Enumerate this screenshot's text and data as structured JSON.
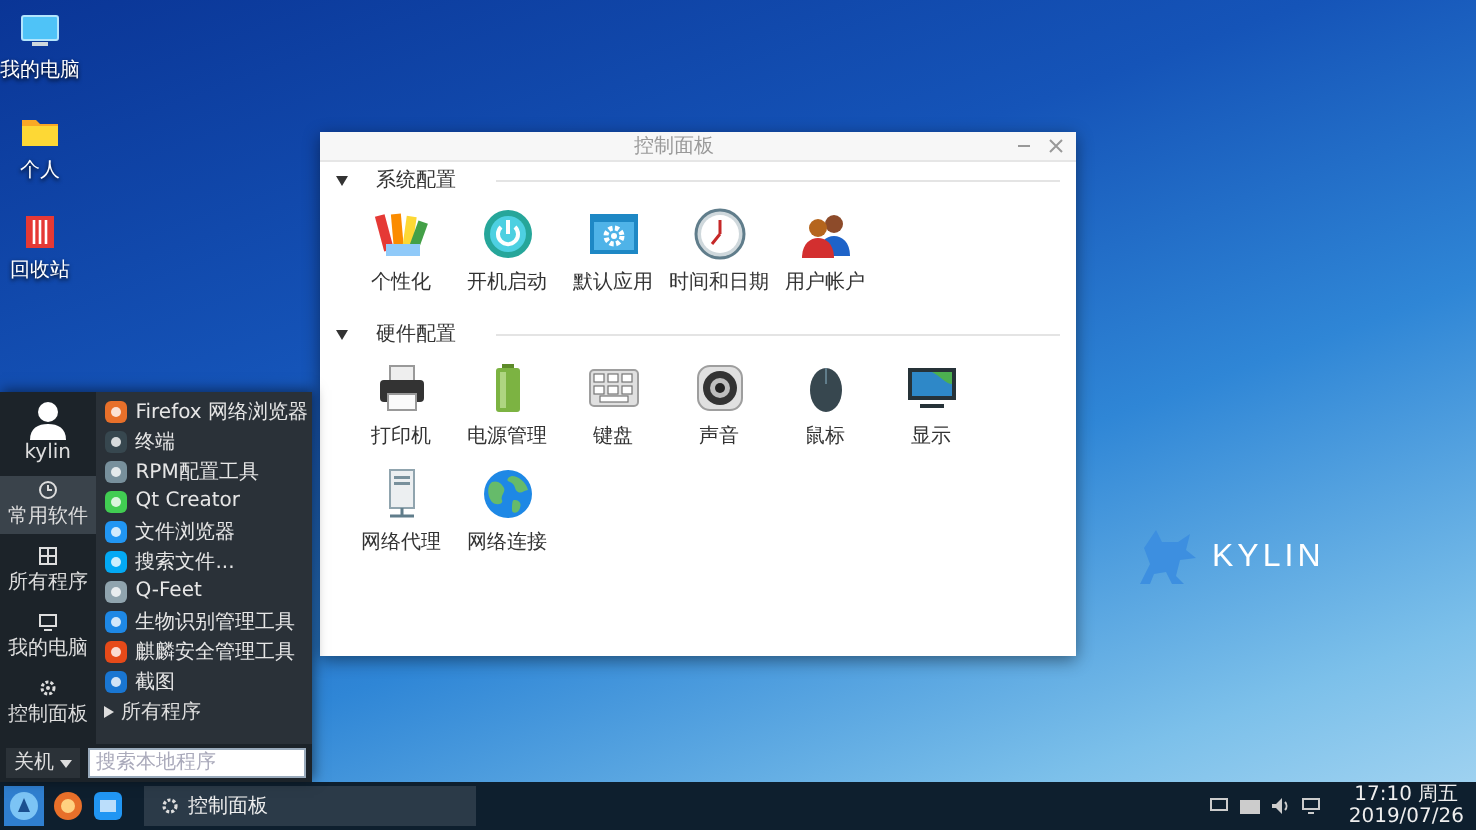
{
  "desktop": {
    "icons": [
      {
        "label": "我的电脑"
      },
      {
        "label": "个人"
      },
      {
        "label": "回收站"
      }
    ],
    "wallpaper_logo": {
      "text": "KYLIN"
    }
  },
  "control_panel": {
    "title": "控制面板",
    "sections": [
      {
        "title": "系统配置",
        "expanded": true,
        "items": [
          {
            "label": "个性化"
          },
          {
            "label": "开机启动"
          },
          {
            "label": "默认应用"
          },
          {
            "label": "时间和日期"
          },
          {
            "label": "用户帐户"
          }
        ]
      },
      {
        "title": "硬件配置",
        "expanded": true,
        "items": [
          {
            "label": "打印机"
          },
          {
            "label": "电源管理"
          },
          {
            "label": "键盘"
          },
          {
            "label": "声音"
          },
          {
            "label": "鼠标"
          },
          {
            "label": "显示"
          },
          {
            "label": "网络代理"
          },
          {
            "label": "网络连接"
          }
        ]
      }
    ]
  },
  "start_menu": {
    "user": "kylin",
    "categories": [
      {
        "label": "常用软件",
        "selected": true
      },
      {
        "label": "所有程序",
        "selected": false
      },
      {
        "label": "我的电脑",
        "selected": false
      },
      {
        "label": "控制面板",
        "selected": false
      }
    ],
    "apps": [
      {
        "label": "Firefox 网络浏览器"
      },
      {
        "label": "终端"
      },
      {
        "label": "RPM配置工具"
      },
      {
        "label": "Qt Creator"
      },
      {
        "label": "文件浏览器"
      },
      {
        "label": "搜索文件..."
      },
      {
        "label": "Q-Feet"
      },
      {
        "label": "生物识别管理工具"
      },
      {
        "label": "麒麟安全管理工具"
      },
      {
        "label": "截图"
      }
    ],
    "all_programs": "所有程序",
    "power_button": "关机",
    "search": {
      "placeholder": "搜索本地程序"
    }
  },
  "taskbar": {
    "tasks": [
      {
        "label": "控制面板"
      }
    ],
    "clock": {
      "time": "17:10 周五",
      "date": "2019/07/26"
    }
  }
}
